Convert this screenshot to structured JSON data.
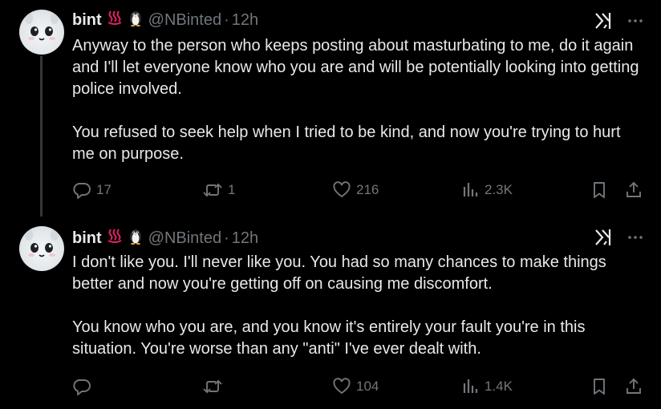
{
  "tweets": [
    {
      "author": {
        "name": "bint",
        "handle": "@NBinted",
        "time": "12h"
      },
      "paragraphs": [
        "Anyway to the person who keeps posting about masturbating to me, do it again and I'll let everyone know who you are and will be potentially looking into getting police involved.",
        "You refused to seek help when I tried to be kind, and now you're trying to hurt me on purpose."
      ],
      "stats": {
        "replies": "17",
        "reposts": "1",
        "likes": "216",
        "views": "2.3K"
      }
    },
    {
      "author": {
        "name": "bint",
        "handle": "@NBinted",
        "time": "12h"
      },
      "paragraphs": [
        "I don't like you. I'll never like you. You had so many chances to make things better and now you're getting off on causing me discomfort.",
        "You know who you are, and you know it's entirely your fault you're in this situation. You're worse than any \"anti\" I've ever dealt with."
      ],
      "stats": {
        "replies": "",
        "reposts": "",
        "likes": "104",
        "views": "1.4K"
      }
    }
  ],
  "separator": "·",
  "icons": {
    "hot_springs": "hot-springs-emoji-icon",
    "penguin": "penguin-emoji-icon",
    "grok": "grok-icon",
    "more": "more-options-icon",
    "reply": "reply-icon",
    "repost": "repost-icon",
    "like": "heart-icon",
    "views": "views-icon",
    "bookmark": "bookmark-icon",
    "share": "share-icon"
  },
  "colors": {
    "background": "#000000",
    "text": "#e7e9ea",
    "muted": "#71767b",
    "thread_line": "#333639",
    "hot_springs": "#e0245e"
  }
}
